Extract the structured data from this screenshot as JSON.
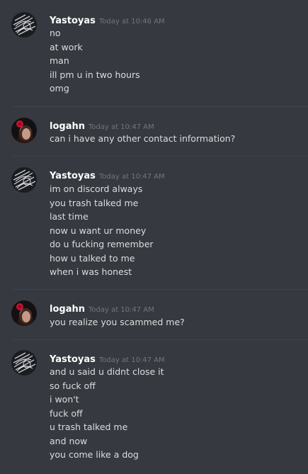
{
  "messages": [
    {
      "username": "Yastoyas",
      "timestamp": "Today at 10:46 AM",
      "avatar_icon": "dark-sketch-avatar-icon",
      "lines": [
        "no",
        "at work",
        "man",
        "ill pm u in two hours",
        "omg"
      ]
    },
    {
      "username": "logahn",
      "timestamp": "Today at 10:47 AM",
      "avatar_icon": "red-flower-portrait-avatar-icon",
      "lines": [
        "can i have any other contact information?"
      ]
    },
    {
      "username": "Yastoyas",
      "timestamp": "Today at 10:47 AM",
      "avatar_icon": "dark-sketch-avatar-icon",
      "lines": [
        "im on discord always",
        "you trash talked me",
        "last time",
        "now u want ur money",
        "do u fucking remember",
        "how u talked to me",
        "when i was honest"
      ]
    },
    {
      "username": "logahn",
      "timestamp": "Today at 10:47 AM",
      "avatar_icon": "red-flower-portrait-avatar-icon",
      "lines": [
        "you realize you scammed me?"
      ]
    },
    {
      "username": "Yastoyas",
      "timestamp": "Today at 10:47 AM",
      "avatar_icon": "dark-sketch-avatar-icon",
      "lines": [
        "and u said u didnt close it",
        "so fuck off",
        "i won't",
        "fuck off",
        "u trash talked me",
        "and now",
        "you come like a dog"
      ]
    }
  ],
  "colors": {
    "background": "#36393f",
    "divider": "#40444b",
    "username": "#ffffff",
    "timestamp": "#72767d",
    "text": "#dcddde"
  }
}
